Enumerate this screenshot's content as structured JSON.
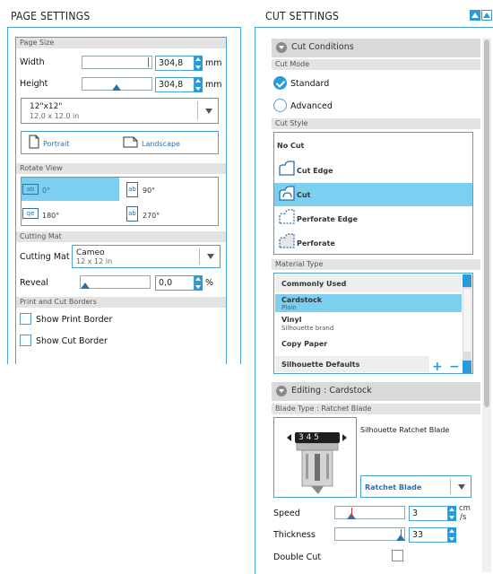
{
  "page_settings": {
    "title": "PAGE SETTINGS",
    "page_size": {
      "header": "Page Size",
      "width_label": "Width",
      "width_value": "304,8",
      "height_label": "Height",
      "height_value": "304,8",
      "unit": "mm",
      "preset_name": "12\"x12\"",
      "preset_detail": "12.0 x 12.0 in"
    },
    "orientation": {
      "portrait_label": "Portrait",
      "landscape_label": "Landscape"
    },
    "rotate_view": {
      "header": "Rotate View",
      "options": [
        "0°",
        "90°",
        "180°",
        "270°"
      ],
      "selected": "0°"
    },
    "cutting_mat": {
      "header": "Cutting Mat",
      "label": "Cutting Mat",
      "value": "Cameo",
      "detail": "12 x 12 in",
      "reveal_label": "Reveal",
      "reveal_value": "0,0",
      "reveal_unit": "%"
    },
    "print_cut_borders": {
      "header": "Print and Cut Borders",
      "show_print_border": "Show Print Border",
      "show_cut_border": "Show Cut Border"
    }
  },
  "cut_settings": {
    "title": "CUT SETTINGS",
    "cut_conditions": {
      "header": "Cut Conditions",
      "cut_mode_header": "Cut Mode",
      "mode_standard": "Standard",
      "mode_advanced": "Advanced",
      "selected_mode": "Standard",
      "cut_style_header": "Cut Style",
      "styles": [
        "No Cut",
        "Cut Edge",
        "Cut",
        "Perforate Edge",
        "Perforate"
      ],
      "selected_style": "Cut",
      "material_type_header": "Material Type",
      "materials": [
        {
          "name": "Commonly Used",
          "sub": ""
        },
        {
          "name": "Cardstock",
          "sub": "Plain"
        },
        {
          "name": "Vinyl",
          "sub": "Silhouette brand"
        },
        {
          "name": "Copy Paper",
          "sub": ""
        },
        {
          "name": "Silhouette Defaults",
          "sub": ""
        }
      ],
      "selected_material": "Cardstock"
    },
    "editing": {
      "header": "Editing : Cardstock",
      "blade_type_header": "Blade Type : Ratchet Blade",
      "blade_name": "Silhouette Ratchet Blade",
      "blade_dial": "3 4 5",
      "blade_select": "Ratchet Blade",
      "speed_label": "Speed",
      "speed_value": "3",
      "speed_unit": "cm/s",
      "speed_unit_top": "cm",
      "speed_unit_bottom": "/s",
      "speed_level": 0.23,
      "thickness_label": "Thickness",
      "thickness_value": "33",
      "thickness_level": 0.95,
      "double_cut_label": "Double Cut"
    }
  },
  "colors": {
    "accent": "#4aa3d6",
    "selection": "#7dcff0",
    "section_header": "#e3e3e3"
  }
}
